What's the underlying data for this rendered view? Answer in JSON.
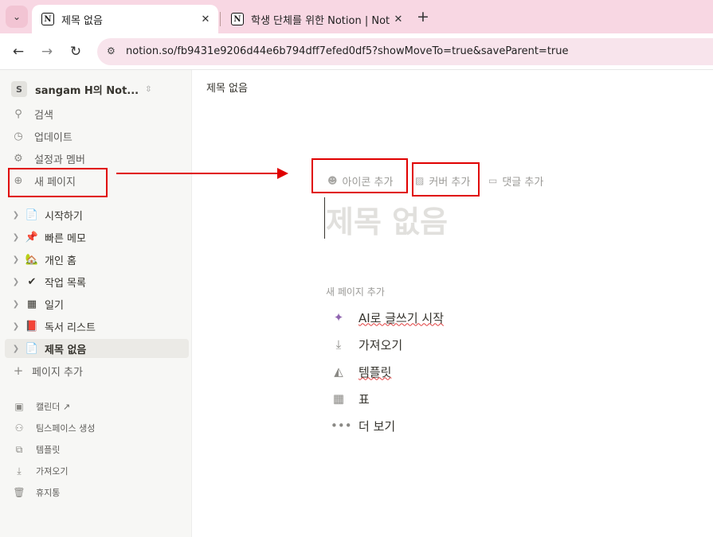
{
  "browser": {
    "tabs": [
      {
        "title": "제목 없음",
        "active": true
      },
      {
        "title": "학생 단체를 위한 Notion | Noti",
        "active": false
      }
    ],
    "url": "notion.so/fb9431e9206d44e6b794dff7efed0df5?showMoveTo=true&saveParent=true"
  },
  "sidebar": {
    "workspace": {
      "avatar": "S",
      "name": "sangam H의 Not..."
    },
    "top_items": [
      {
        "icon": "search-icon",
        "label": "검색"
      },
      {
        "icon": "clock-icon",
        "label": "업데이트"
      },
      {
        "icon": "gear-icon",
        "label": "설정과 멤버"
      },
      {
        "icon": "plus-circle-icon",
        "label": "새 페이지"
      }
    ],
    "pages": [
      {
        "emoji": "📄",
        "label": "시작하기"
      },
      {
        "emoji": "📌",
        "label": "빠른 메모"
      },
      {
        "emoji": "🏡",
        "label": "개인 홈"
      },
      {
        "emoji": "✔",
        "label": "작업 목록"
      },
      {
        "emoji": "▦",
        "label": "일기"
      },
      {
        "emoji": "📕",
        "label": "독서 리스트"
      },
      {
        "emoji": "📄",
        "label": "제목 없음",
        "selected": true
      }
    ],
    "add_page": "페이지 추가",
    "bottom_items": [
      {
        "icon": "calendar-icon",
        "label": "캘린더 ↗"
      },
      {
        "icon": "team-icon",
        "label": "팀스페이스 생성"
      },
      {
        "icon": "template-icon",
        "label": "템플릿"
      },
      {
        "icon": "import-icon",
        "label": "가져오기"
      },
      {
        "icon": "trash-icon",
        "label": "휴지통"
      }
    ]
  },
  "main": {
    "breadcrumb": "제목 없음",
    "actions": [
      {
        "icon": "smiley-icon",
        "label": "아이콘 추가"
      },
      {
        "icon": "image-icon",
        "label": "커버 추가"
      },
      {
        "icon": "comment-icon",
        "label": "댓글 추가"
      }
    ],
    "title_placeholder": "제목 없음",
    "new_page_label": "새 페이지 추가",
    "options": [
      {
        "icon": "sparkle-icon",
        "label": "AI로 글쓰기 시작"
      },
      {
        "icon": "download-icon",
        "label": "가져오기"
      },
      {
        "icon": "shapes-icon",
        "label": "템플릿"
      },
      {
        "icon": "table-icon",
        "label": "표"
      },
      {
        "icon": "more-icon",
        "label": "더 보기"
      }
    ]
  },
  "colors": {
    "annotation": "#e00000",
    "tab_bar": "#f8d7e3",
    "sidebar": "#f7f7f5"
  }
}
